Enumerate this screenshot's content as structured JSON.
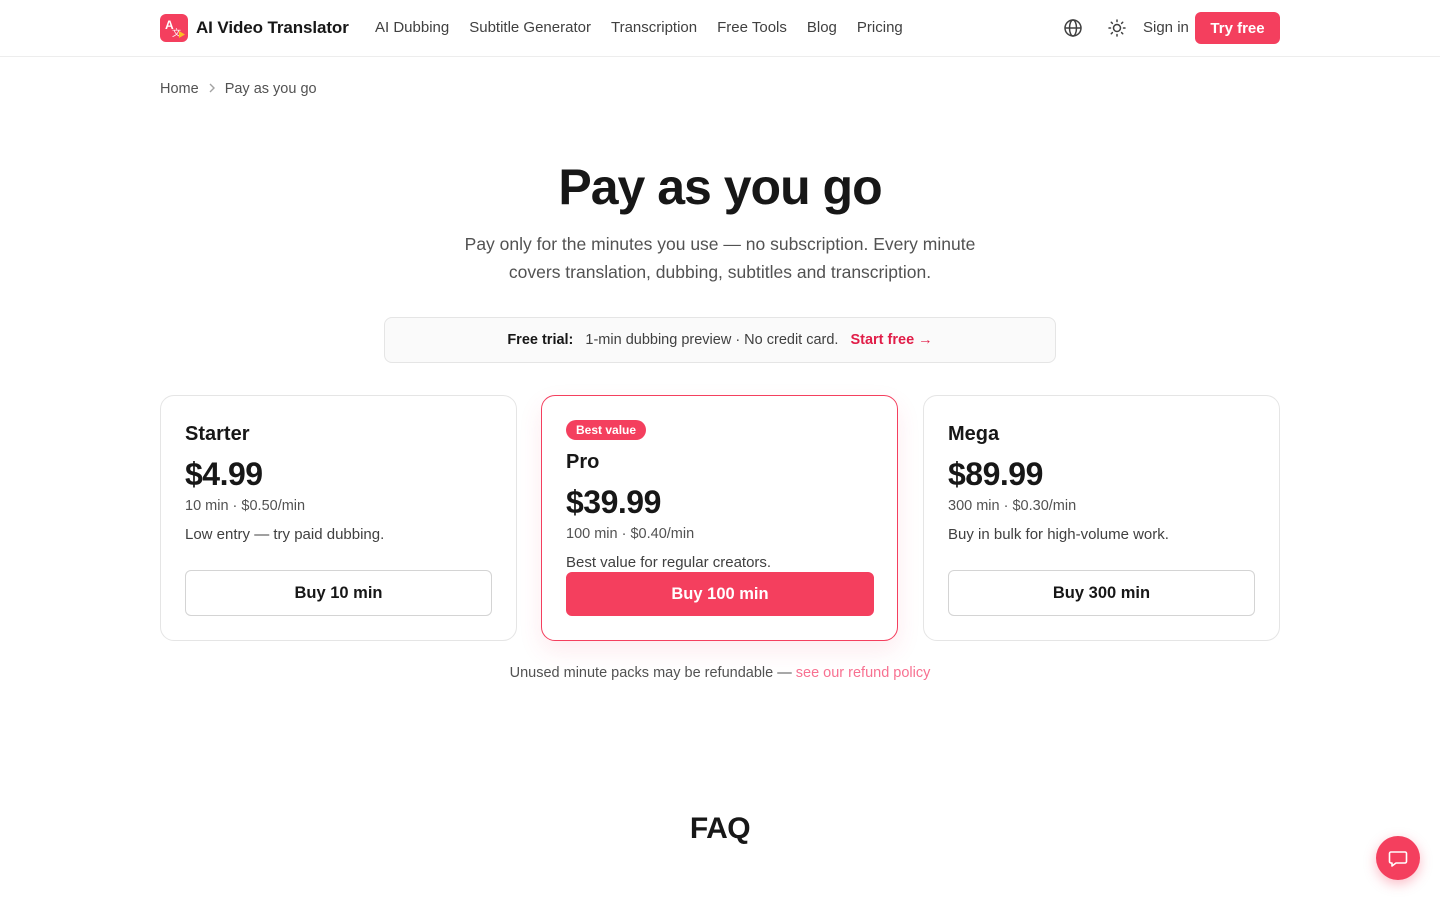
{
  "header": {
    "brand": "AI Video Translator",
    "nav": [
      "AI Dubbing",
      "Subtitle Generator",
      "Transcription",
      "Free Tools",
      "Blog",
      "Pricing"
    ],
    "icons": {
      "language": "globe-icon",
      "theme": "sun-icon"
    },
    "sign_in": "Sign in",
    "try_free": "Try free"
  },
  "breadcrumb": {
    "home": "Home",
    "separator_icon": "chevron-right-icon",
    "current": "Pay as you go"
  },
  "hero": {
    "title": "Pay as you go",
    "subtitle": "Pay only for the minutes you use — no subscription. Every minute covers translation, dubbing, subtitles and transcription."
  },
  "trial": {
    "label": "Free trial:",
    "text": "1-min dubbing preview · No credit card.",
    "cta": "Start free →"
  },
  "plans": [
    {
      "name": "Starter",
      "price": "$4.99",
      "meta": "10 min · $0.50/min",
      "desc": "Low entry — try paid dubbing.",
      "button": "Buy 10 min"
    },
    {
      "badge": "Best value",
      "name": "Pro",
      "price": "$39.99",
      "meta": "100 min · $0.40/min",
      "desc": "Best value for regular creators.",
      "button": "Buy 100 min"
    },
    {
      "name": "Mega",
      "price": "$89.99",
      "meta": "300 min · $0.30/min",
      "desc": "Buy in bulk for high-volume work.",
      "button": "Buy 300 min"
    }
  ],
  "refund": {
    "text": "Unused minute packs may be refundable — ",
    "link": "see our refund policy"
  },
  "faq": {
    "title": "FAQ"
  },
  "chat": {
    "icon": "chat-bubble-icon"
  },
  "colors": {
    "accent": "#f43f5e",
    "text": "#171717",
    "muted": "#525252",
    "border": "#e5e5e5"
  }
}
